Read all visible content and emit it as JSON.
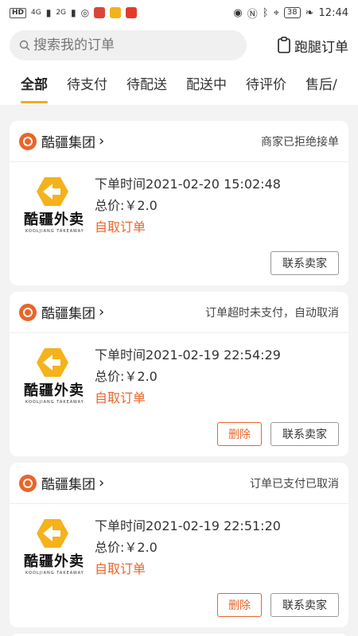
{
  "status_bar": {
    "left_chip": "HD",
    "net1": "4G",
    "net2": "2G",
    "battery": "38",
    "time": "12:44"
  },
  "search": {
    "placeholder": "搜索我的订单"
  },
  "errand": {
    "label": "跑腿订单"
  },
  "tabs": [
    {
      "label": "全部",
      "active": true
    },
    {
      "label": "待支付"
    },
    {
      "label": "待配送"
    },
    {
      "label": "配送中"
    },
    {
      "label": "待评价"
    },
    {
      "label": "售后/"
    }
  ],
  "brand_logo": {
    "name": "酷疆外卖",
    "sub": "KOOLJIANG TAKEAWAY"
  },
  "colors": {
    "accent_orange": "#e8662a",
    "tab_underline": "#f2aa22",
    "brand_yellow": "#f5b21b"
  },
  "orders": [
    {
      "shop": "酷疆集团",
      "status": "商家已拒绝接单",
      "order_time": "下单时间2021-02-20 15:02:48",
      "total": "总价:￥2.0",
      "type": "自取订单",
      "delete_label": "",
      "contact_label": "联系卖家"
    },
    {
      "shop": "酷疆集团",
      "status": "订单超时未支付，自动取消",
      "order_time": "下单时间2021-02-19 22:54:29",
      "total": "总价:￥2.0",
      "type": "自取订单",
      "delete_label": "删除",
      "contact_label": "联系卖家"
    },
    {
      "shop": "酷疆集团",
      "status": "订单已支付已取消",
      "order_time": "下单时间2021-02-19 22:51:20",
      "total": "总价:￥2.0",
      "type": "自取订单",
      "delete_label": "删除",
      "contact_label": "联系卖家"
    }
  ]
}
